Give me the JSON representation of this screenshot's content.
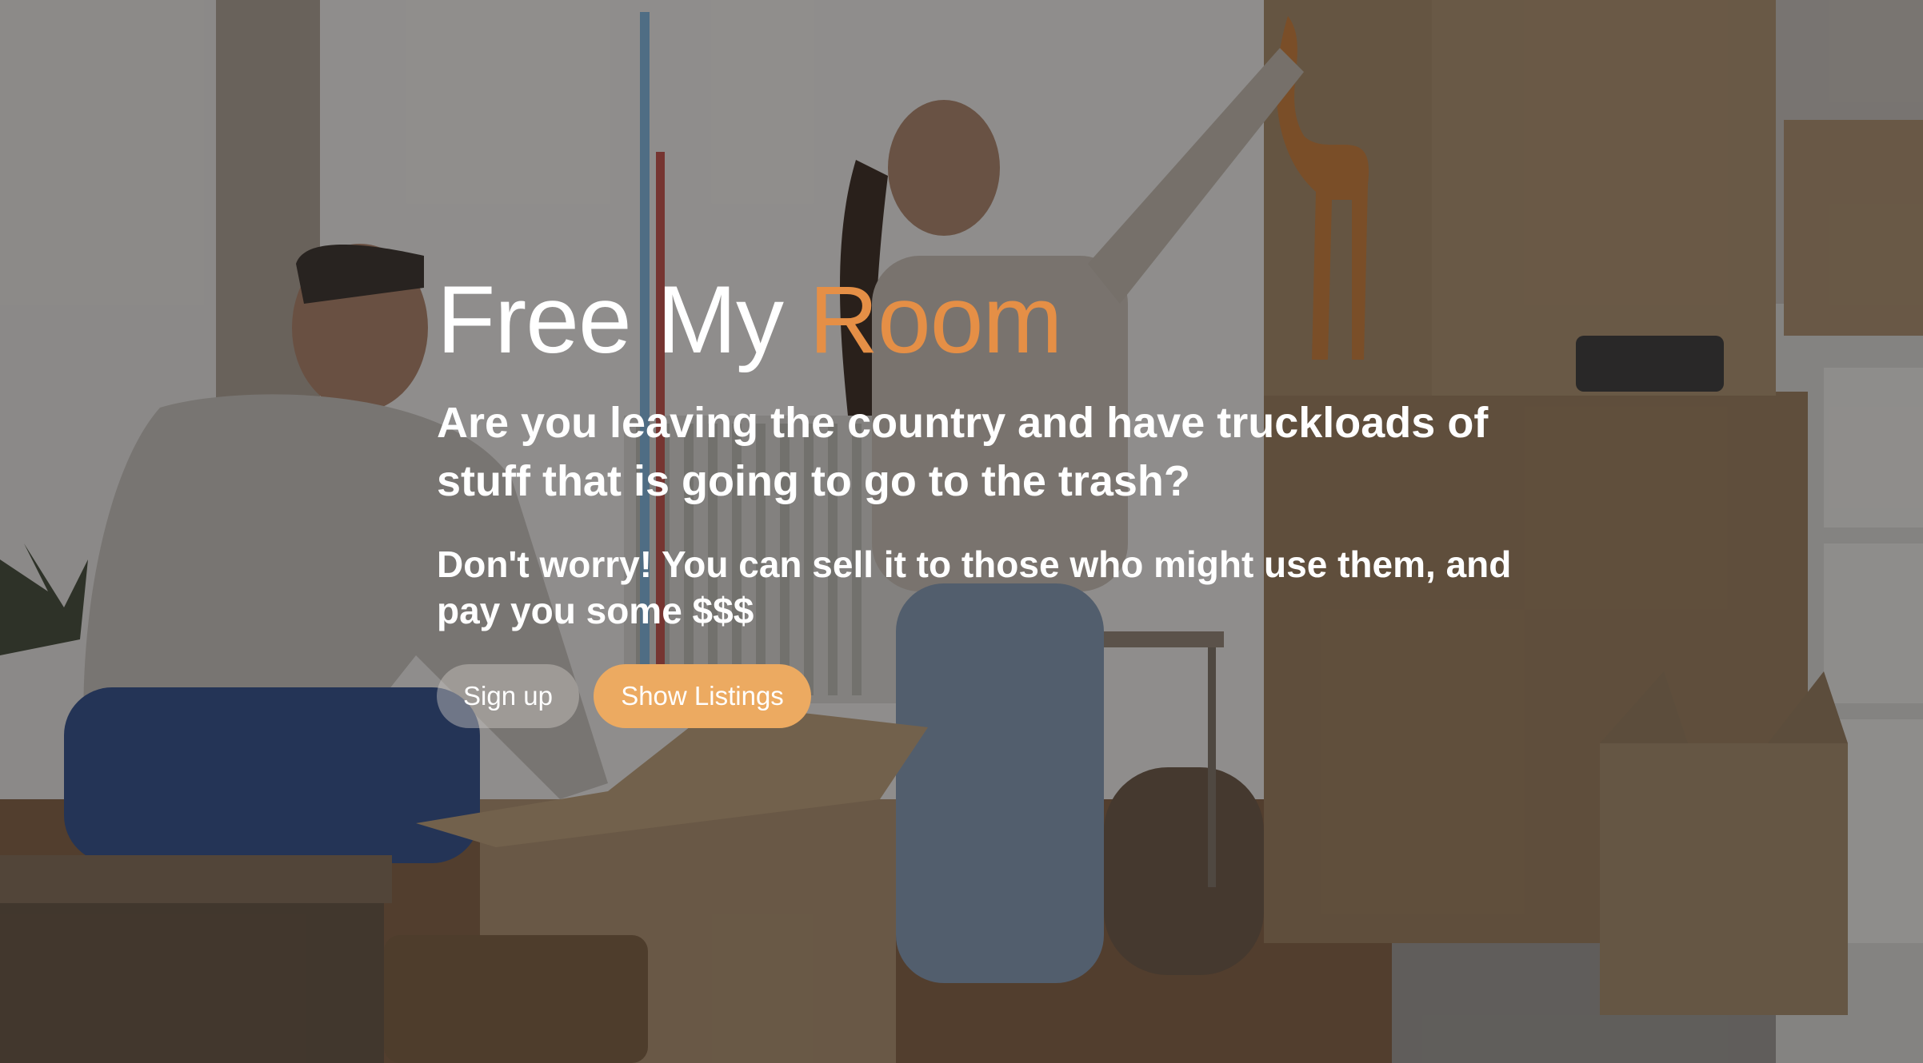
{
  "hero": {
    "title_part1": "Free My ",
    "title_accent": "Room",
    "lead": "Are you leaving the country and have truckloads of stuff that is going to go to the trash?",
    "sub": "Don't worry! You can sell it to those who might use them, and pay you some $$$"
  },
  "actions": {
    "signup_label": "Sign up",
    "listings_label": "Show Listings"
  },
  "colors": {
    "accent": "#e58f46",
    "listings_button": "#ecaa61",
    "text": "#ffffff"
  },
  "background": {
    "icon": "moving-boxes-photo"
  }
}
